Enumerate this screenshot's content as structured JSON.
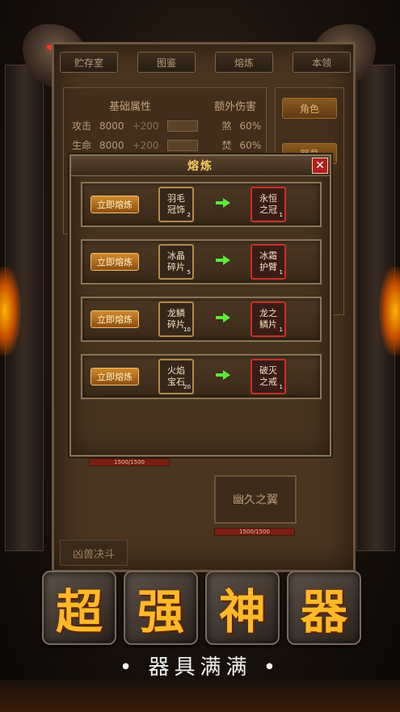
{
  "base": {
    "tabs": [
      "贮存室",
      "图鉴",
      "熔炼",
      "本领"
    ],
    "attr_title": "基础属性",
    "extra_title": "额外伤害",
    "attrs": [
      {
        "label": "攻击",
        "value": "8000",
        "plus": "+200",
        "ex_label": "煞",
        "ex_value": "60%"
      },
      {
        "label": "生命",
        "value": "8000",
        "plus": "+200",
        "ex_label": "焚",
        "ex_value": "60%"
      }
    ],
    "right_buttons": [
      "角色",
      "器具"
    ],
    "item_name": "幽久之翼",
    "hp_text_1": "1500/1500",
    "hp_text_2": "1500/1500",
    "beast_label": "凶兽决斗"
  },
  "dialog": {
    "title": "熔炼",
    "recipes": [
      {
        "button": "立即熔炼",
        "input": "羽毛冠饰",
        "input_qty": "2",
        "output": "永恒之冠",
        "output_qty": "1"
      },
      {
        "button": "立即熔炼",
        "input": "冰晶碎片",
        "input_qty": "5",
        "output": "冰霜护臂",
        "output_qty": "1"
      },
      {
        "button": "立即熔炼",
        "input": "龙鳞碎片",
        "input_qty": "10",
        "output": "龙之鳞片",
        "output_qty": "1"
      },
      {
        "button": "立即熔炼",
        "input": "火焰宝石",
        "input_qty": "20",
        "output": "破灭之戒",
        "output_qty": "1"
      }
    ]
  },
  "banner": {
    "tiles": [
      "超",
      "强",
      "神",
      "器"
    ],
    "subtitle": "• 器具满满 •"
  },
  "colors": {
    "accent": "#f0c85a",
    "button": "#d08a2c",
    "close": "#b41e1e",
    "tile_text": "#ffb928"
  }
}
